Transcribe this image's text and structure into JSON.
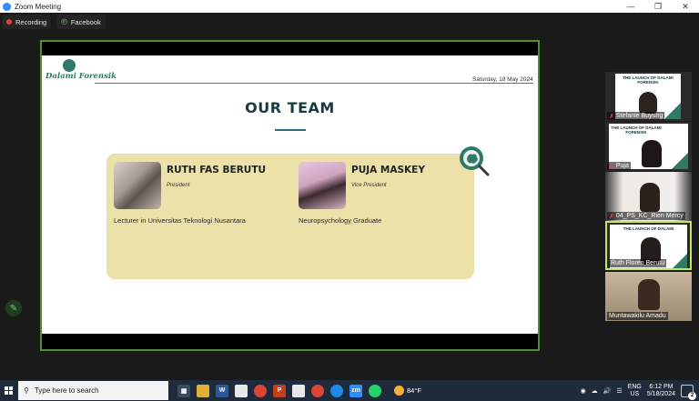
{
  "window": {
    "title": "Zoom Meeting"
  },
  "meeting_bar": {
    "recording_label": "Recording",
    "live_label": "Facebook"
  },
  "slide": {
    "logo_text": "Dalami Forensik",
    "date": "Saturday, 18 May 2024",
    "heading": "OUR TEAM",
    "members": [
      {
        "name": "RUTH FAS BERUTU",
        "role": "President",
        "description": "Lecturer in Universitas Teknologi Nusantara"
      },
      {
        "name": "PUJA MASKEY",
        "role": "Vice President",
        "description": "Neuropsychology Graduate"
      }
    ]
  },
  "participants": [
    {
      "name": "Stefanie Buyung",
      "muted": true,
      "thumb_title": "THE LAUNCH OF DALAMI FORENSIK"
    },
    {
      "name": "Puja",
      "muted": true,
      "thumb_title": "THE LAUNCH OF DALAMI FORENSIK"
    },
    {
      "name": "04_PS_KC_Rien Mercy",
      "muted": true
    },
    {
      "name": "Ruth Floren Berutu",
      "muted": false,
      "active_speaker": true,
      "thumb_title": "THE LAUNCH OF DALAMI"
    },
    {
      "name": "Muntawakilu Amadu",
      "muted": false
    }
  ],
  "taskbar": {
    "search_placeholder": "Type here to search",
    "weather": "84°F",
    "language_top": "ENG",
    "language_bottom": "US",
    "time": "6:12 PM",
    "date": "5/18/2024",
    "notification_count": "2"
  },
  "colors": {
    "accent_green": "#4e8d3a",
    "card_bg": "#ede1aa",
    "teal": "#2f7a66",
    "taskbar": "#1f2a3a"
  }
}
